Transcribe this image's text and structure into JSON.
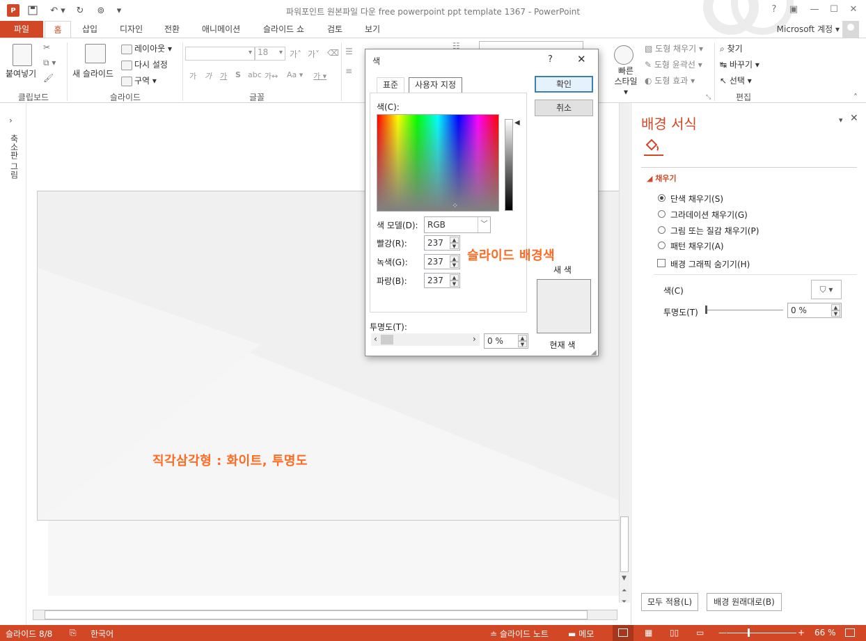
{
  "window": {
    "title": "파워포인트 원본파일 다운 free powerpoint ppt template 1367 - PowerPoint",
    "help": "?",
    "account": "Microsoft 계정"
  },
  "qat": {
    "logo": "P",
    "icons": [
      "powerpoint-logo-icon",
      "save-icon",
      "undo-icon",
      "redo-icon",
      "present-icon",
      "customize-icon"
    ]
  },
  "tabs": [
    "파일",
    "홈",
    "삽입",
    "디자인",
    "전환",
    "애니메이션",
    "슬라이드 쇼",
    "검토",
    "보기"
  ],
  "ribbon": {
    "clipboard": {
      "paste": "붙여넣기",
      "label": "클립보드"
    },
    "slides": {
      "new_slide": "새 슬라이드",
      "layout": "레이아웃",
      "reset": "다시 설정",
      "section": "구역",
      "label": "슬라이드"
    },
    "font": {
      "font_name": "",
      "font_size": "18",
      "label": "글꼴"
    },
    "drawing": {
      "quick_styles": "빠른 스타일",
      "shape_fill": "도형 채우기",
      "shape_outline": "도형 윤곽선",
      "shape_effects": "도형 효과"
    },
    "editing": {
      "find": "찾기",
      "replace": "바꾸기",
      "select": "선택",
      "label": "편집"
    }
  },
  "thumbstrip": {
    "label": "축소판 그림"
  },
  "slide": {
    "note_triangle": "직각삼각형 : 화이트, 투명도",
    "note_bg": "슬라이드 배경색"
  },
  "dialog": {
    "title": "색",
    "help": "?",
    "tab_standard": "표준",
    "tab_custom": "사용자 지정",
    "colors_label": "색(C):",
    "color_model_label": "색 모델(D):",
    "color_model_value": "RGB",
    "red_label": "빨강(R):",
    "green_label": "녹색(G):",
    "blue_label": "파랑(B):",
    "red": "237",
    "green": "237",
    "blue": "237",
    "transparency_label": "투명도(T):",
    "transparency_value": "0 %",
    "ok": "확인",
    "cancel": "취소",
    "new_label": "새 색",
    "current_label": "현재 색",
    "swatch_color": "#ededed"
  },
  "pane": {
    "title": "배경 서식",
    "section": "채우기",
    "options": [
      "단색 채우기(S)",
      "그라데이션 채우기(G)",
      "그림 또는 질감 채우기(P)",
      "패턴 채우기(A)"
    ],
    "hide_graphics": "배경 그래픽 숨기기(H)",
    "color_label": "색(C)",
    "transparency_label": "투명도(T)",
    "transparency_value": "0 %",
    "apply_all": "모두 적용(L)",
    "reset_bg": "배경 원래대로(B)"
  },
  "status": {
    "slide": "슬라이드 8/8",
    "language": "한국어",
    "notes": "슬라이드 노트",
    "comments": "메모",
    "zoom": "66 %"
  },
  "colors": {
    "accent": "#d24726",
    "note": "#ff6a20"
  }
}
